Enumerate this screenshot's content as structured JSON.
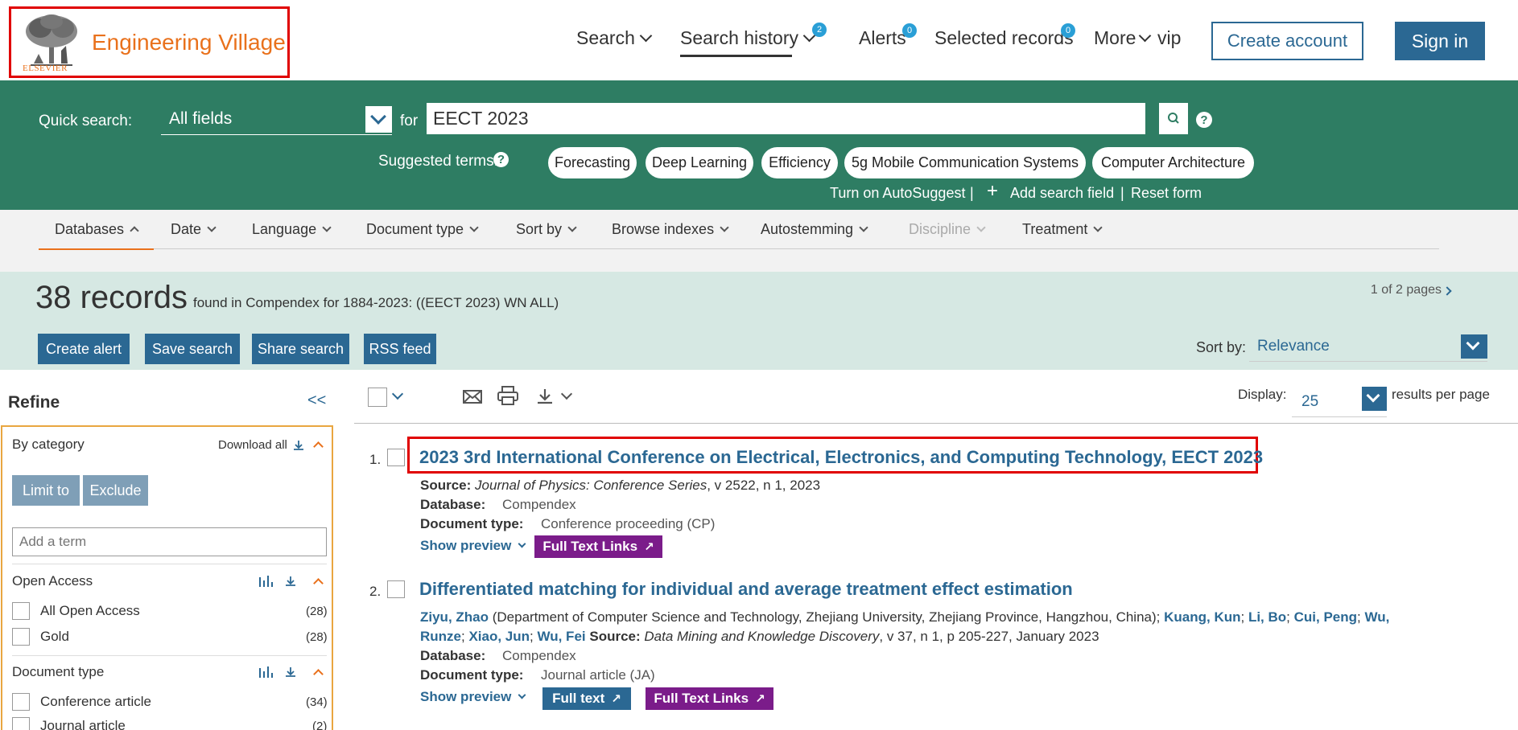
{
  "header": {
    "logo_text": "Engineering Village",
    "logo_publisher": "ELSEVIER",
    "nav": {
      "search": "Search",
      "search_history": "Search history",
      "search_history_badge": "2",
      "alerts": "Alerts",
      "alerts_badge": "0",
      "selected_records": "Selected records",
      "selected_records_badge": "0",
      "more": "More",
      "vip": "vip"
    },
    "create_account": "Create account",
    "sign_in": "Sign in"
  },
  "quick_search": {
    "label": "Quick search:",
    "field": "All fields",
    "for_label": "for",
    "query": "EECT 2023",
    "suggested_label": "Suggested terms:",
    "suggested_terms": [
      "Forecasting",
      "Deep Learning",
      "Efficiency",
      "5g Mobile Communication Systems",
      "Computer Architecture"
    ],
    "autosuggest": "Turn on AutoSuggest",
    "add_field": "Add search field",
    "reset": "Reset form",
    "separator": "|"
  },
  "filters": {
    "databases": "Databases",
    "date": "Date",
    "language": "Language",
    "document_type": "Document type",
    "sort_by": "Sort by",
    "browse_indexes": "Browse indexes",
    "autostemming": "Autostemming",
    "discipline": "Discipline",
    "treatment": "Treatment"
  },
  "results_header": {
    "count": "38 records",
    "description": "found in Compendex for 1884-2023: ((EECT 2023) WN ALL)",
    "pages": "1 of 2 pages",
    "actions": {
      "create_alert": "Create alert",
      "save_search": "Save search",
      "share_search": "Share search",
      "rss_feed": "RSS feed"
    },
    "sort_label": "Sort by:",
    "sort_value": "Relevance"
  },
  "refine": {
    "title": "Refine",
    "collapse": "<<",
    "by_category": "By category",
    "download_all": "Download all",
    "limit_to": "Limit to",
    "exclude": "Exclude",
    "add_term_placeholder": "Add a term",
    "sections": [
      {
        "title": "Open Access",
        "items": [
          {
            "label": "All Open Access",
            "count": "(28)"
          },
          {
            "label": "Gold",
            "count": "(28)"
          }
        ]
      },
      {
        "title": "Document type",
        "items": [
          {
            "label": "Conference article",
            "count": "(34)"
          },
          {
            "label": "Journal article",
            "count": "(2)"
          }
        ]
      }
    ]
  },
  "toolbar": {
    "display_label": "Display:",
    "display_value": "25",
    "rpp_label": "results per page"
  },
  "results": [
    {
      "num": "1.",
      "title": "2023 3rd International Conference on Electrical, Electronics, and Computing Technology, EECT 2023",
      "source_label": "Source:",
      "source_journal": "Journal of Physics: Conference Series",
      "source_detail": ", v 2522, n 1, 2023",
      "database_label": "Database:",
      "database": "Compendex",
      "doctype_label": "Document type:",
      "doctype": "Conference proceeding (CP)",
      "show_preview": "Show preview",
      "full_text_links": "Full Text Links"
    },
    {
      "num": "2.",
      "title": "Differentiated matching for individual and average treatment effect estimation",
      "author1": "Ziyu, Zhao",
      "affiliation": " (Department of Computer Science and Technology, Zhejiang University, Zhejiang Province, Hangzhou, China); ",
      "authors_more_line1": [
        "Kuang, Kun",
        "Li, Bo",
        "Cui, Peng",
        "Wu,"
      ],
      "authors_more_line2": [
        "Runze",
        "Xiao, Jun",
        "Wu, Fei"
      ],
      "source_label": "Source:",
      "source_journal": "Data Mining and Knowledge Discovery",
      "source_detail": ", v 37, n 1, p 205-227, January 2023",
      "database_label": "Database:",
      "database": "Compendex",
      "doctype_label": "Document type:",
      "doctype": "Journal article (JA)",
      "show_preview": "Show preview",
      "full_text": "Full text",
      "full_text_links": "Full Text Links"
    }
  ]
}
